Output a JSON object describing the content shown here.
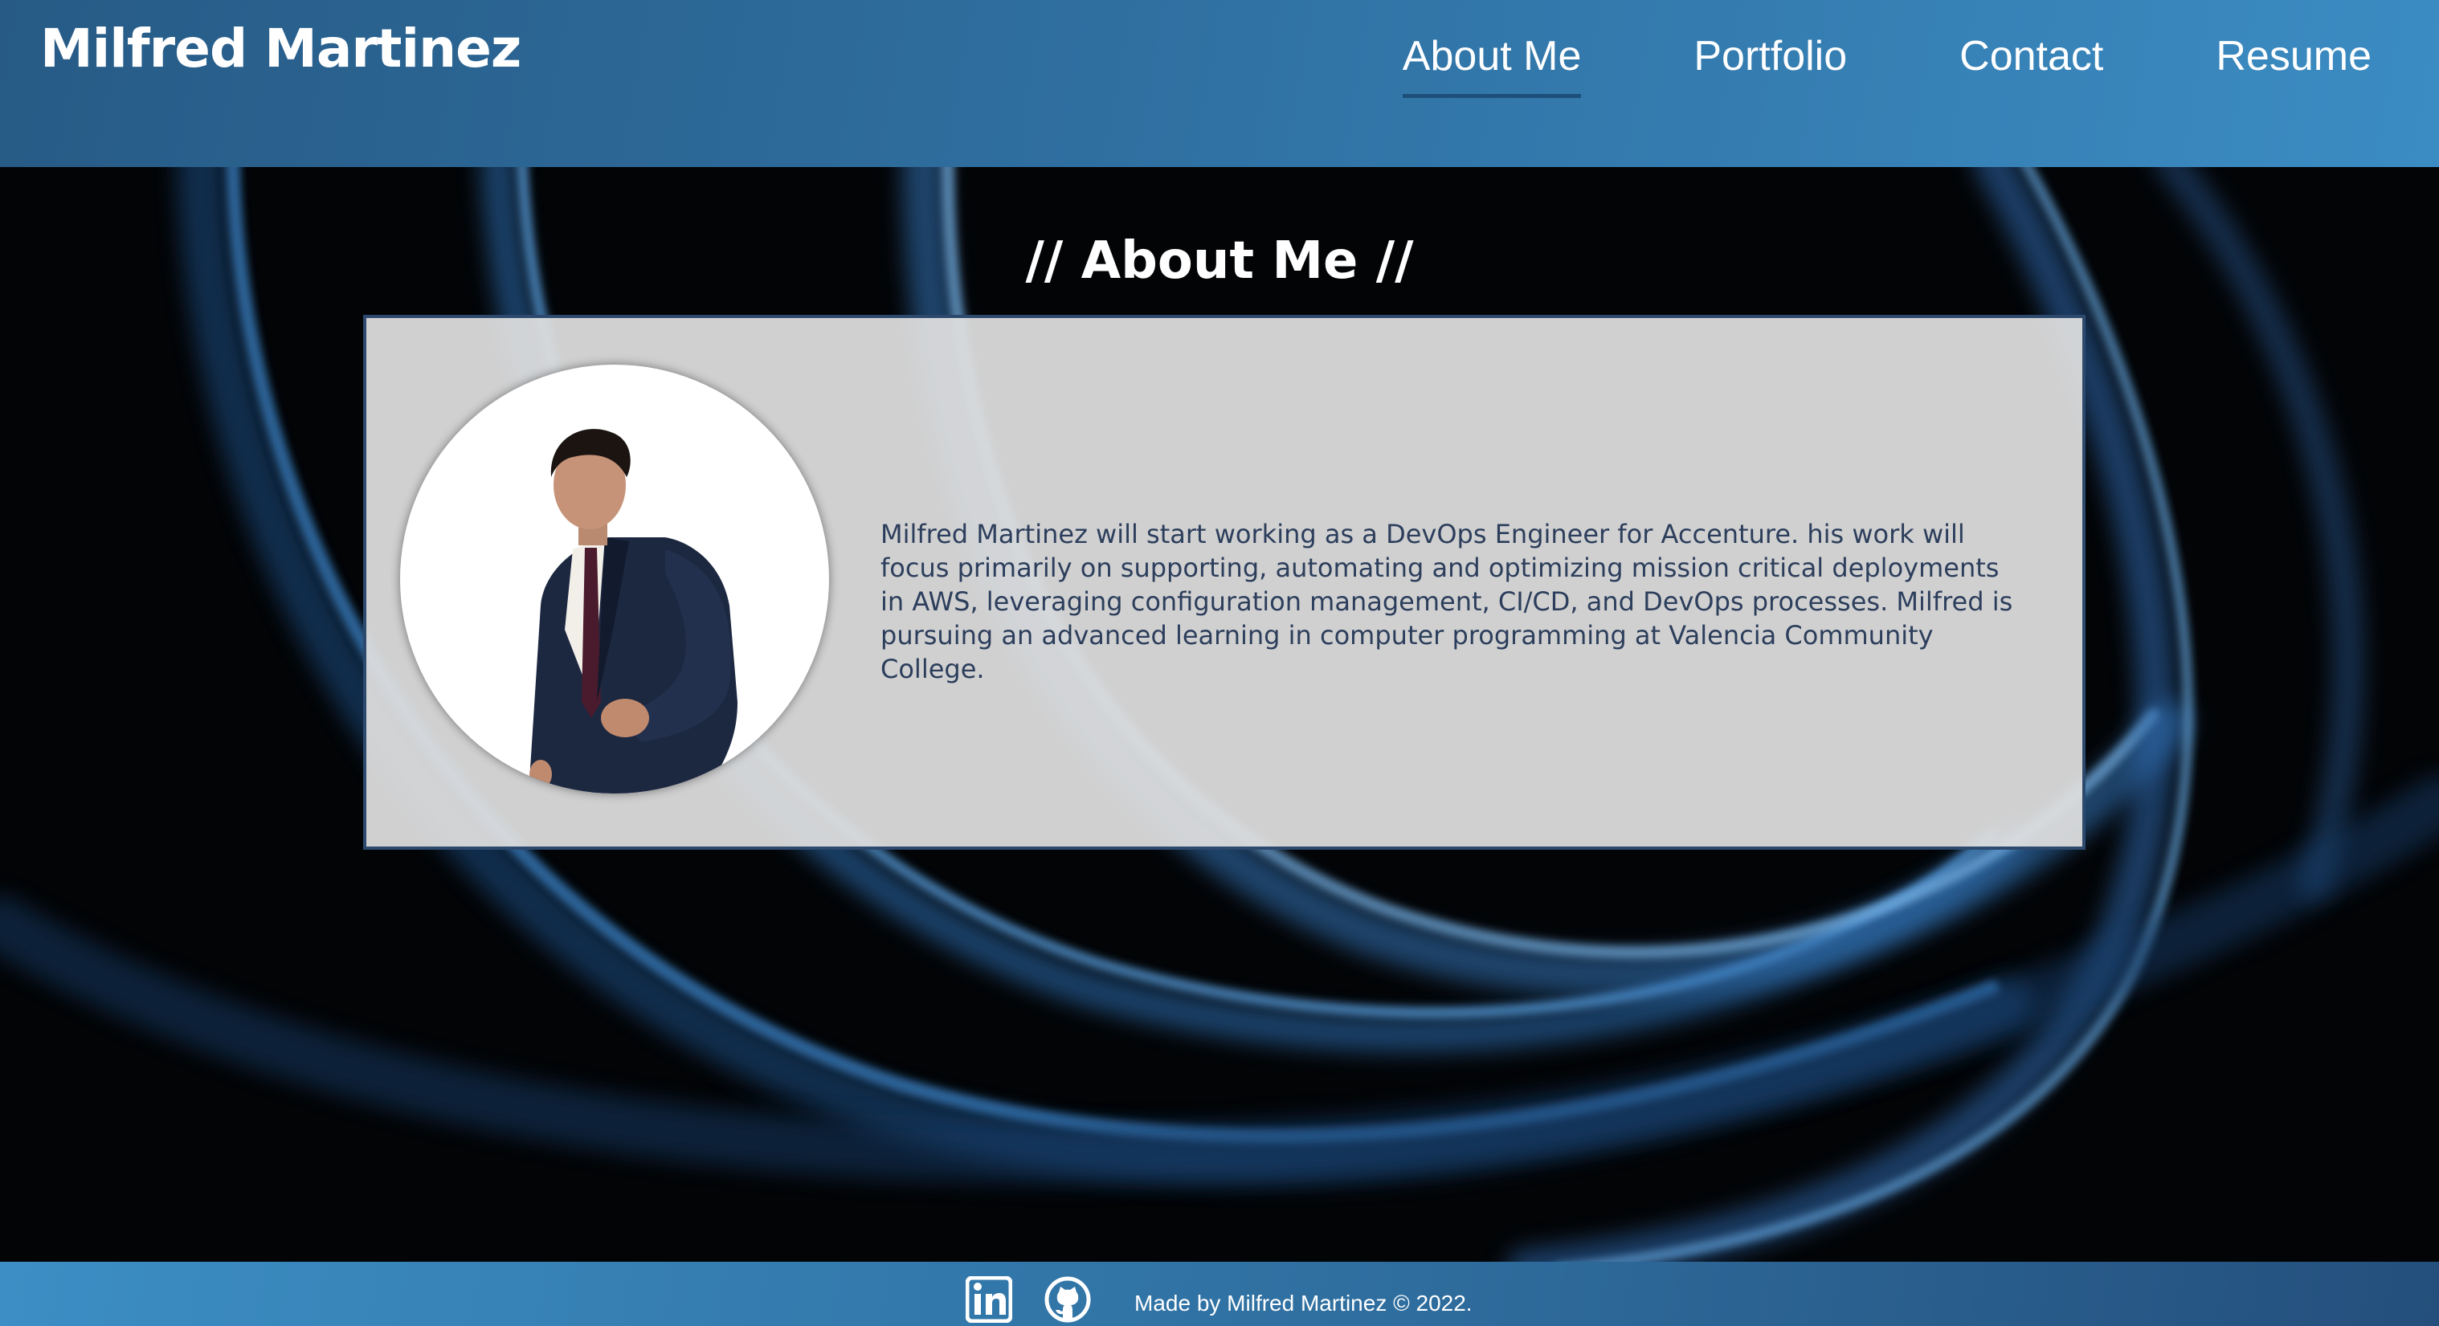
{
  "header": {
    "brand": "Milfred Martinez",
    "nav": [
      {
        "label": "About Me",
        "active": true
      },
      {
        "label": "Portfolio",
        "active": false
      },
      {
        "label": "Contact",
        "active": false
      },
      {
        "label": "Resume",
        "active": false
      }
    ]
  },
  "about": {
    "title": "// About Me //",
    "bio": "Milfred Martinez will start working as a DevOps Engineer for Accenture. his work will focus primarily on supporting, automating and optimizing mission critical deployments in AWS, leveraging configuration management, CI/CD, and DevOps processes. Milfred is pursuing an advanced learning in computer programming at Valencia Community College."
  },
  "footer": {
    "icons": [
      "linkedin-icon",
      "github-icon"
    ],
    "credit": "Made by Milfred Martinez © 2022."
  },
  "colors": {
    "header_start": "#275b86",
    "header_end": "#3b8cc3",
    "card_border": "#2d4a6e",
    "bio_text": "#2c3e5c",
    "nav_underline": "#1e4f7a"
  }
}
